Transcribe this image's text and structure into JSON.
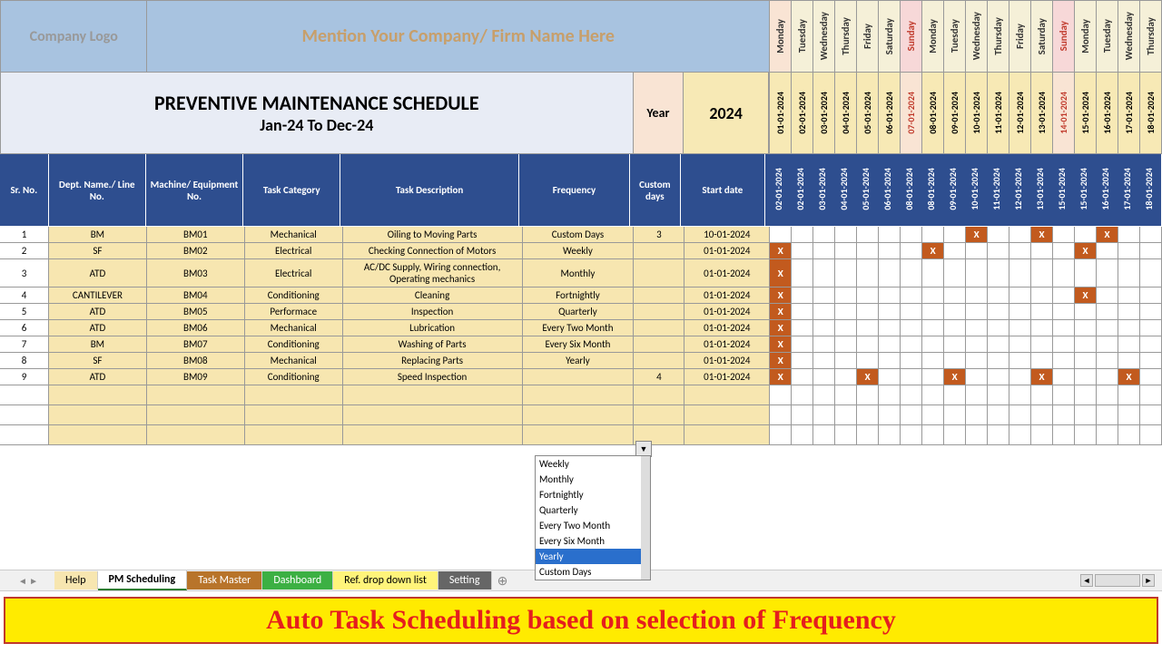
{
  "logo_text": "Company Logo",
  "company_text": "Mention Your Company/ Firm Name Here",
  "title1": "PREVENTIVE MAINTENANCE SCHEDULE",
  "title2": "Jan-24 To Dec-24",
  "year_label": "Year",
  "year_val": "2024",
  "days": [
    "Monday",
    "Tuesday",
    "Wednesday",
    "Thursday",
    "Friday",
    "Saturday",
    "Sunday",
    "Monday",
    "Tuesday",
    "Wednesday",
    "Thursday",
    "Friday",
    "Saturday",
    "Sunday",
    "Monday",
    "Tuesday",
    "Wednesday",
    "Thursday"
  ],
  "dates": [
    "01-01-2024",
    "02-01-2024",
    "03-01-2024",
    "04-01-2024",
    "05-01-2024",
    "06-01-2024",
    "07-01-2024",
    "08-01-2024",
    "09-01-2024",
    "10-01-2024",
    "11-01-2024",
    "12-01-2024",
    "13-01-2024",
    "14-01-2024",
    "15-01-2024",
    "16-01-2024",
    "17-01-2024",
    "18-01-2024"
  ],
  "date_hdrs": [
    "02-01-2024",
    "02-01-2024",
    "03-01-2024",
    "04-01-2024",
    "05-01-2024",
    "06-01-2024",
    "08-01-2024",
    "08-01-2024",
    "09-01-2024",
    "10-01-2024",
    "11-01-2024",
    "12-01-2024",
    "13-01-2024",
    "15-01-2024",
    "15-01-2024",
    "16-01-2024",
    "17-01-2024",
    "18-01-2024"
  ],
  "sundays": [
    6,
    13
  ],
  "mondays": [
    0
  ],
  "headers": {
    "sr": "Sr. No.",
    "dept": "Dept. Name./ Line No.",
    "mach": "Machine/ Equipment No.",
    "cat": "Task Category",
    "desc": "Task Description",
    "freq": "Frequency",
    "cust": "Custom days",
    "start": "Start date"
  },
  "rows": [
    {
      "sr": "1",
      "dept": "BM",
      "mach": "BM01",
      "cat": "Mechanical",
      "desc": "Oiling to Moving Parts",
      "freq": "Custom Days",
      "cust": "3",
      "start": "10-01-2024",
      "x": [
        9,
        12,
        15
      ]
    },
    {
      "sr": "2",
      "dept": "SF",
      "mach": "BM02",
      "cat": "Electrical",
      "desc": "Checking Connection of Motors",
      "freq": "Weekly",
      "cust": "",
      "start": "01-01-2024",
      "x": [
        0,
        7,
        14
      ]
    },
    {
      "sr": "3",
      "dept": "ATD",
      "mach": "BM03",
      "cat": "Electrical",
      "desc": "AC/DC Supply, Wiring connection, Operating mechanics",
      "freq": "Monthly",
      "cust": "",
      "start": "01-01-2024",
      "x": [
        0
      ]
    },
    {
      "sr": "4",
      "dept": "CANTILEVER",
      "mach": "BM04",
      "cat": "Conditioning",
      "desc": "Cleaning",
      "freq": "Fortnightly",
      "cust": "",
      "start": "01-01-2024",
      "x": [
        0,
        14
      ]
    },
    {
      "sr": "5",
      "dept": "ATD",
      "mach": "BM05",
      "cat": "Performace",
      "desc": "Inspection",
      "freq": "Quarterly",
      "cust": "",
      "start": "01-01-2024",
      "x": [
        0
      ]
    },
    {
      "sr": "6",
      "dept": "ATD",
      "mach": "BM06",
      "cat": "Mechanical",
      "desc": "Lubrication",
      "freq": "Every Two Month",
      "cust": "",
      "start": "01-01-2024",
      "x": [
        0
      ]
    },
    {
      "sr": "7",
      "dept": "BM",
      "mach": "BM07",
      "cat": "Conditioning",
      "desc": "Washing of Parts",
      "freq": "Every Six Month",
      "cust": "",
      "start": "01-01-2024",
      "x": [
        0
      ]
    },
    {
      "sr": "8",
      "dept": "SF",
      "mach": "BM08",
      "cat": "Mechanical",
      "desc": "Replacing Parts",
      "freq": "Yearly",
      "cust": "",
      "start": "01-01-2024",
      "x": [
        0
      ]
    },
    {
      "sr": "9",
      "dept": "ATD",
      "mach": "BM09",
      "cat": "Conditioning",
      "desc": "Speed Inspection",
      "freq": "",
      "cust": "4",
      "start": "01-01-2024",
      "x": [
        0,
        4,
        8,
        12,
        16
      ]
    }
  ],
  "dropdown": [
    "Weekly",
    "Monthly",
    "Fortnightly",
    "Quarterly",
    "Every Two Month",
    "Every Six Month",
    "Yearly",
    "Custom Days"
  ],
  "dd_selected": "Yearly",
  "tabs": {
    "help": "Help",
    "pm": "PM Scheduling",
    "task": "Task Master",
    "dash": "Dashboard",
    "ref": "Ref. drop down list",
    "set": "Setting"
  },
  "banner": "Auto Task Scheduling based on selection of Frequency"
}
